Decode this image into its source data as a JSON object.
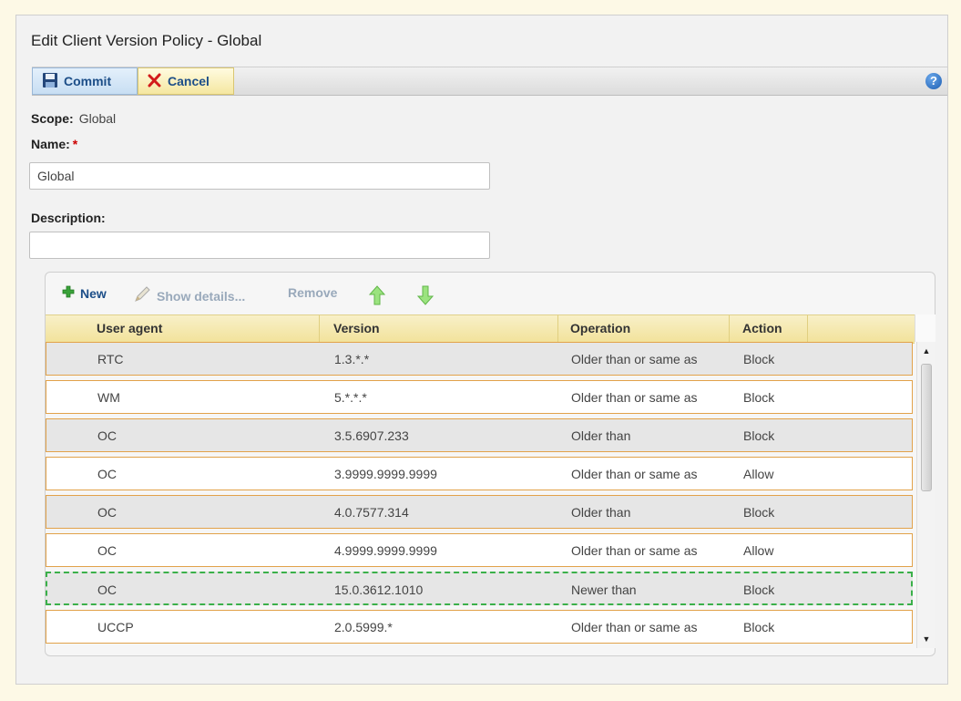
{
  "window": {
    "title": "Edit Client Version Policy - Global"
  },
  "toolbar": {
    "commit_label": "Commit",
    "cancel_label": "Cancel",
    "help_glyph": "?"
  },
  "form": {
    "scope_label": "Scope:",
    "scope_value": "Global",
    "name_label": "Name:",
    "name_required_mark": "*",
    "name_value": "Global",
    "description_label": "Description:",
    "description_value": ""
  },
  "grid_toolbar": {
    "new_label": "New",
    "show_details_label": "Show details...",
    "remove_label": "Remove",
    "move_up_icon": "green-up-arrow-icon",
    "move_down_icon": "green-down-arrow-icon"
  },
  "table": {
    "columns": [
      "User agent",
      "Version",
      "Operation",
      "Action"
    ],
    "rows": [
      {
        "user_agent": "RTC",
        "version": "1.3.*.*",
        "operation": "Older than or same as",
        "action": "Block"
      },
      {
        "user_agent": "WM",
        "version": "5.*.*.*",
        "operation": "Older than or same as",
        "action": "Block"
      },
      {
        "user_agent": "OC",
        "version": "3.5.6907.233",
        "operation": "Older than",
        "action": "Block"
      },
      {
        "user_agent": "OC",
        "version": "3.9999.9999.9999",
        "operation": "Older than or same as",
        "action": "Allow"
      },
      {
        "user_agent": "OC",
        "version": "4.0.7577.314",
        "operation": "Older than",
        "action": "Block"
      },
      {
        "user_agent": "OC",
        "version": "4.9999.9999.9999",
        "operation": "Older than or same as",
        "action": "Allow"
      },
      {
        "user_agent": "OC",
        "version": "15.0.3612.1010",
        "operation": "Newer than",
        "action": "Block"
      },
      {
        "user_agent": "UCCP",
        "version": "2.0.5999.*",
        "operation": "Older than or same as",
        "action": "Block"
      }
    ]
  },
  "colors": {
    "accent": "#1c4e88",
    "row_border": "#e2a24a",
    "drop_indicator": "#3bb04a",
    "header_bg": "#f2e29a"
  }
}
